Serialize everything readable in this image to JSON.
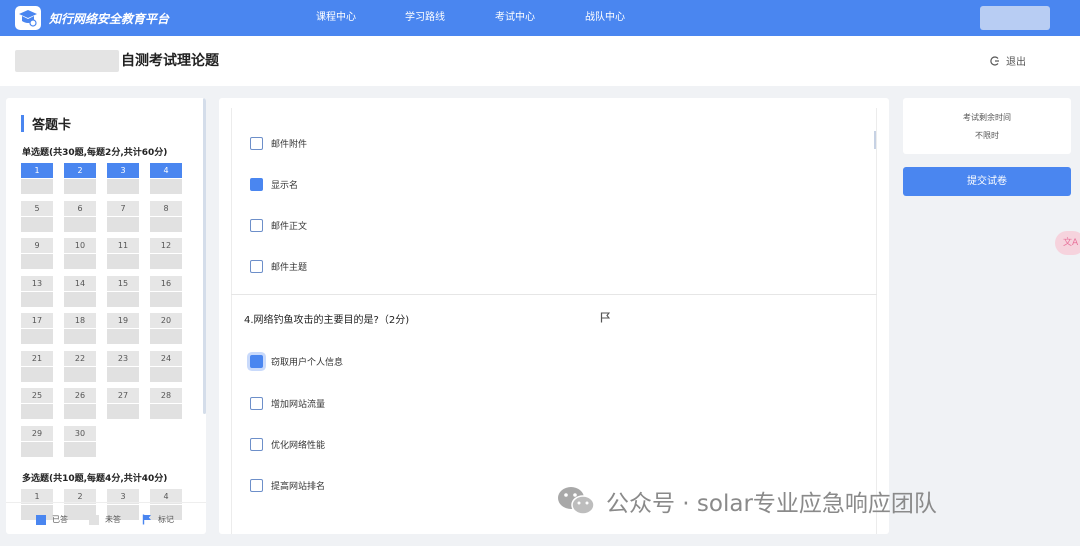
{
  "header": {
    "logo_text": "知行网络安全教育平台",
    "nav": [
      "课程中心",
      "学习路线",
      "考试中心",
      "战队中心"
    ],
    "accent_color": "#4a86f0"
  },
  "subheader": {
    "title": "自测考试理论题",
    "exit_label": "退出"
  },
  "answer_card": {
    "title": "答题卡",
    "single_section": {
      "title": "单选题(共30题,每题2分,共计60分)",
      "questions": [
        {
          "n": "1",
          "answered": true
        },
        {
          "n": "2",
          "answered": true
        },
        {
          "n": "3",
          "answered": true
        },
        {
          "n": "4",
          "answered": true
        },
        {
          "n": "5",
          "answered": false
        },
        {
          "n": "6",
          "answered": false
        },
        {
          "n": "7",
          "answered": false
        },
        {
          "n": "8",
          "answered": false
        },
        {
          "n": "9",
          "answered": false
        },
        {
          "n": "10",
          "answered": false
        },
        {
          "n": "11",
          "answered": false
        },
        {
          "n": "12",
          "answered": false
        },
        {
          "n": "13",
          "answered": false
        },
        {
          "n": "14",
          "answered": false
        },
        {
          "n": "15",
          "answered": false
        },
        {
          "n": "16",
          "answered": false
        },
        {
          "n": "17",
          "answered": false
        },
        {
          "n": "18",
          "answered": false
        },
        {
          "n": "19",
          "answered": false
        },
        {
          "n": "20",
          "answered": false
        },
        {
          "n": "21",
          "answered": false
        },
        {
          "n": "22",
          "answered": false
        },
        {
          "n": "23",
          "answered": false
        },
        {
          "n": "24",
          "answered": false
        },
        {
          "n": "25",
          "answered": false
        },
        {
          "n": "26",
          "answered": false
        },
        {
          "n": "27",
          "answered": false
        },
        {
          "n": "28",
          "answered": false
        },
        {
          "n": "29",
          "answered": false
        },
        {
          "n": "30",
          "answered": false
        }
      ]
    },
    "multi_section": {
      "title": "多选题(共10题,每题4分,共计40分)",
      "questions": [
        {
          "n": "1",
          "answered": false
        },
        {
          "n": "2",
          "answered": false
        },
        {
          "n": "3",
          "answered": false
        },
        {
          "n": "4",
          "answered": false
        }
      ]
    },
    "legend": {
      "answered": "已答",
      "unanswered": "未答",
      "flagged": "标记"
    }
  },
  "question_area": {
    "prev_options": [
      {
        "label": "邮件附件",
        "checked": false
      },
      {
        "label": "显示名",
        "checked": true
      },
      {
        "label": "邮件正文",
        "checked": false
      },
      {
        "label": "邮件主题",
        "checked": false
      }
    ],
    "current_question": {
      "text": "4.网络钓鱼攻击的主要目的是?（2分)",
      "options": [
        {
          "label": "窃取用户个人信息",
          "checked": true
        },
        {
          "label": "增加网站流量",
          "checked": false
        },
        {
          "label": "优化网络性能",
          "checked": false
        },
        {
          "label": "提高网站排名",
          "checked": false
        }
      ]
    }
  },
  "sidebar_right": {
    "timer_label": "考试剩余时间",
    "timer_value": "不限时",
    "submit_label": "提交试卷",
    "translate_label": "文A"
  },
  "watermark": {
    "text": "公众号 · solar专业应急响应团队"
  }
}
